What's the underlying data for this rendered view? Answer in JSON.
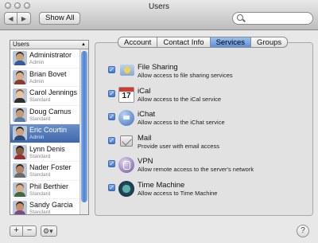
{
  "window": {
    "title": "Users"
  },
  "toolbar": {
    "back_glyph": "◀",
    "forward_glyph": "▶",
    "show_all_label": "Show All",
    "search_placeholder": "",
    "search_icon": "magnifier-icon"
  },
  "sidebar": {
    "header": "Users",
    "sort_glyph": "▲",
    "users": [
      {
        "name": "Administrator",
        "role": "Admin",
        "skin": "#c9a27e",
        "hair": "#3b2a1c",
        "shirt": "#345c9a"
      },
      {
        "name": "Brian Bovet",
        "role": "Admin",
        "skin": "#d8ad88",
        "hair": "#4b3424",
        "shirt": "#8a3b2b"
      },
      {
        "name": "Carol Jennings",
        "role": "Standard",
        "skin": "#e7c2a3",
        "hair": "#8b5a2b",
        "shirt": "#2f2f2f"
      },
      {
        "name": "Doug Camus",
        "role": "Standard",
        "skin": "#c99b74",
        "hair": "#2a2a2a",
        "shirt": "#5a7aa8"
      },
      {
        "name": "Eric Courtin",
        "role": "Admin",
        "skin": "#d2a17c",
        "hair": "#1f1f1f",
        "shirt": "#2b4a7a"
      },
      {
        "name": "Lynn Denis",
        "role": "Standard",
        "skin": "#8a5a3c",
        "hair": "#1c120c",
        "shirt": "#9a2f2f"
      },
      {
        "name": "Nader Foster",
        "role": "Standard",
        "skin": "#b58566",
        "hair": "#2e2018",
        "shirt": "#6b6b6b"
      },
      {
        "name": "Phil Berthier",
        "role": "Standard",
        "skin": "#d7b08e",
        "hair": "#6a4a30",
        "shirt": "#3e6a3e"
      },
      {
        "name": "Sandy Garcia",
        "role": "Standard",
        "skin": "#c68f6a",
        "hair": "#3a2416",
        "shirt": "#7a4a8a"
      }
    ],
    "selected_index": 4
  },
  "tabs": [
    {
      "label": "Account",
      "active": false
    },
    {
      "label": "Contact Info",
      "active": false
    },
    {
      "label": "Services",
      "active": true
    },
    {
      "label": "Groups",
      "active": false
    }
  ],
  "services": [
    {
      "name": "File Sharing",
      "desc": "Allow access to file sharing services",
      "checked": true,
      "icon": "file-sharing-icon"
    },
    {
      "name": "iCal",
      "desc": "Allow access to the iCal service",
      "checked": true,
      "icon": "ical-icon",
      "cal_day": "17"
    },
    {
      "name": "iChat",
      "desc": "Allow access to the iChat service",
      "checked": true,
      "icon": "ichat-icon"
    },
    {
      "name": "Mail",
      "desc": "Provide user with email access",
      "checked": true,
      "icon": "mail-icon"
    },
    {
      "name": "VPN",
      "desc": "Allow remote access to the server's network",
      "checked": true,
      "icon": "vpn-icon"
    },
    {
      "name": "Time Machine",
      "desc": "Allow access to Time Machine",
      "checked": true,
      "icon": "time-machine-icon"
    }
  ],
  "bottom": {
    "add_glyph": "+",
    "remove_glyph": "−",
    "action_glyph": "⚙▾",
    "help_glyph": "?"
  },
  "colors": {
    "selection": "#3e68ad",
    "active_tab": "#5d8fd8",
    "checkbox": "#3f75c8"
  }
}
